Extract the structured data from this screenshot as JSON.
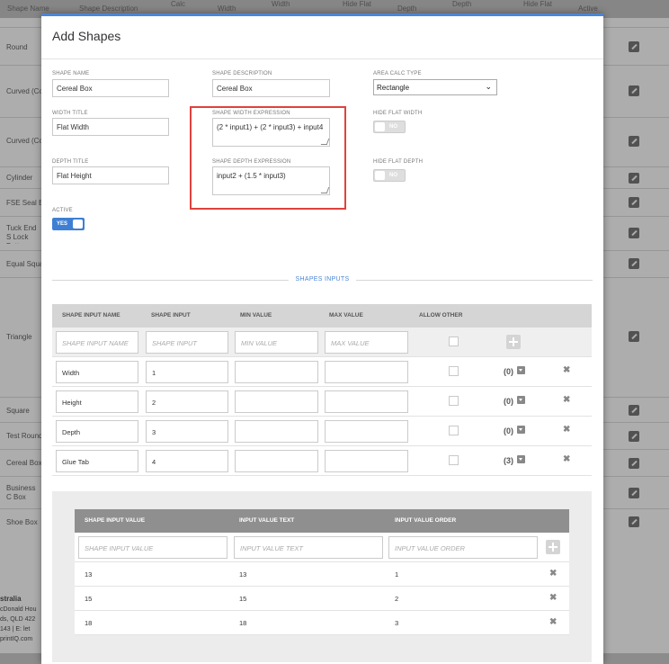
{
  "background": {
    "columns": [
      "Shape Name",
      "Shape Description",
      "Calc",
      "Width",
      "Width",
      "Hide Flat",
      "Depth",
      "Depth",
      "Hide Flat",
      "Active"
    ],
    "rows": [
      "Round",
      "Curved (Co",
      "Curved (Co",
      "Cylinder",
      "FSE Seal E",
      "Tuck End S Lock Botto",
      "Equal Squa",
      "Triangle",
      "Square",
      "Test Round",
      "Cereal Box",
      "Business C Box",
      "Shoe Box"
    ],
    "footer": [
      "stralia",
      "cDonald Hou",
      "ds, QLD 422",
      "143 | E: let",
      "printIQ.com"
    ]
  },
  "modal": {
    "title": "Add Shapes",
    "shape_name": {
      "label": "SHAPE NAME",
      "value": "Cereal Box"
    },
    "shape_description": {
      "label": "SHAPE DESCRIPTION",
      "value": "Cereal Box"
    },
    "area_calc_type": {
      "label": "AREA CALC TYPE",
      "value": "Rectangle"
    },
    "width_title": {
      "label": "WIDTH TITLE",
      "value": "Flat Width"
    },
    "shape_width_expression": {
      "label": "SHAPE WIDTH EXPRESSION",
      "value": "(2 * input1) + (2 * input3) + input4"
    },
    "hide_flat_width": {
      "label": "HIDE FLAT WIDTH",
      "state": "NO"
    },
    "depth_title": {
      "label": "DEPTH TITLE",
      "value": "Flat Height"
    },
    "shape_depth_expression": {
      "label": "SHAPE DEPTH EXPRESSION",
      "value": "input2 + (1.5 * input3)"
    },
    "hide_flat_depth": {
      "label": "HIDE FLAT DEPTH",
      "state": "NO"
    },
    "active": {
      "label": "ACTIVE",
      "state": "YES"
    },
    "section_title": "SHAPES INPUTS",
    "inputs_table": {
      "headers": [
        "SHAPE INPUT NAME",
        "SHAPE INPUT",
        "MIN VALUE",
        "MAX VALUE",
        "ALLOW OTHER"
      ],
      "placeholders": [
        "SHAPE INPUT NAME",
        "SHAPE INPUT",
        "MIN VALUE",
        "MAX VALUE"
      ],
      "rows": [
        {
          "name": "Width",
          "input": "1",
          "count": "(0)"
        },
        {
          "name": "Height",
          "input": "2",
          "count": "(0)"
        },
        {
          "name": "Depth",
          "input": "3",
          "count": "(0)"
        },
        {
          "name": "Glue Tab",
          "input": "4",
          "count": "(3)"
        }
      ]
    },
    "values_table": {
      "headers": [
        "SHAPE INPUT VALUE",
        "INPUT VALUE TEXT",
        "INPUT VALUE ORDER"
      ],
      "placeholders": [
        "SHAPE INPUT VALUE",
        "INPUT VALUE TEXT",
        "INPUT VALUE ORDER"
      ],
      "rows": [
        {
          "value": "13",
          "text": "13",
          "order": "1"
        },
        {
          "value": "15",
          "text": "15",
          "order": "2"
        },
        {
          "value": "18",
          "text": "18",
          "order": "3"
        }
      ]
    }
  }
}
